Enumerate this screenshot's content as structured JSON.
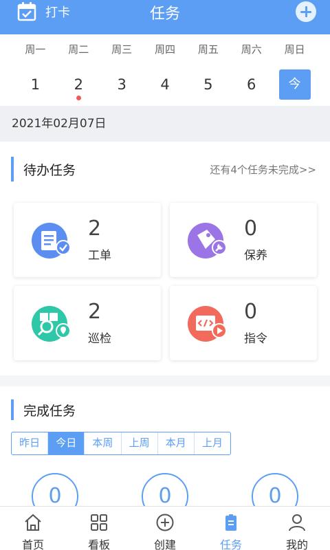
{
  "header": {
    "checkin_label": "打卡",
    "title": "任务"
  },
  "week": {
    "weekdays": [
      "周一",
      "周二",
      "周三",
      "周四",
      "周五",
      "周六",
      "周日"
    ],
    "days": [
      "1",
      "2",
      "3",
      "4",
      "5",
      "6",
      "今"
    ]
  },
  "date": "2021年02月07日",
  "pending": {
    "title": "待办任务",
    "more": "还有4个任务未完成>>",
    "tiles": [
      {
        "count": "2",
        "label": "工单"
      },
      {
        "count": "0",
        "label": "保养"
      },
      {
        "count": "2",
        "label": "巡检"
      },
      {
        "count": "0",
        "label": "指令"
      }
    ]
  },
  "done": {
    "title": "完成任务",
    "tabs": [
      "昨日",
      "今日",
      "本周",
      "上周",
      "本月",
      "上月"
    ],
    "counts": [
      "0",
      "0",
      "0"
    ]
  },
  "nav": [
    "首页",
    "看板",
    "创建",
    "任务",
    "我的"
  ],
  "colors": {
    "accent": "#5b9ef4",
    "dot": "#f05a5a"
  }
}
